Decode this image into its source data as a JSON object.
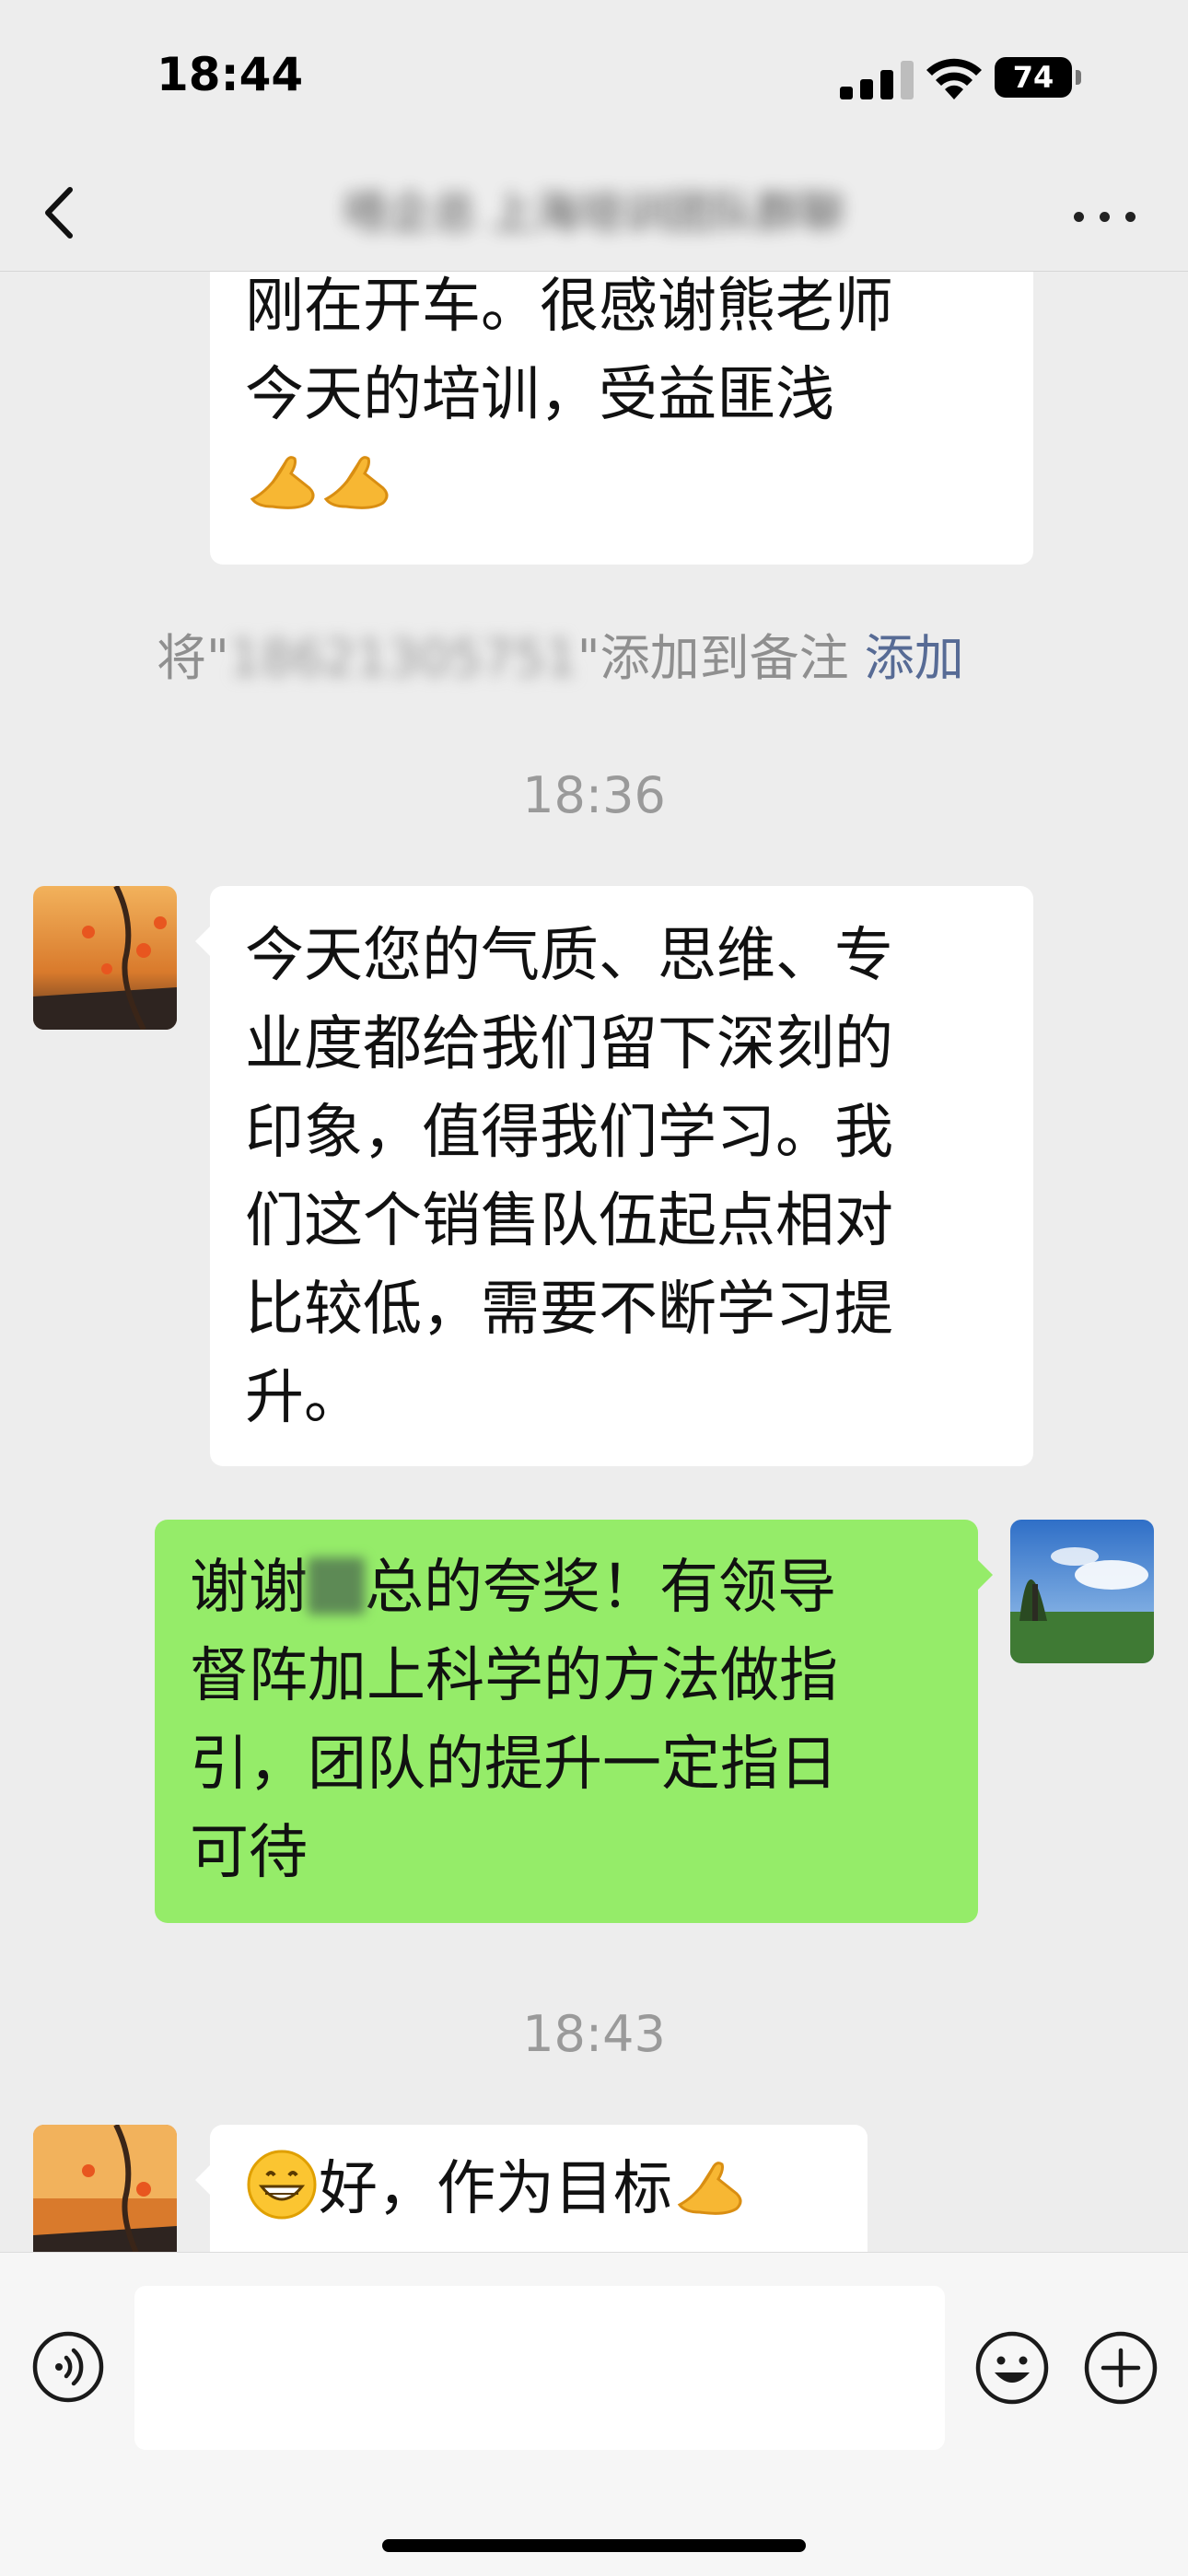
{
  "status_bar": {
    "time": "18:44",
    "battery": "74"
  },
  "nav": {
    "title": "唔企总 上海培训团队群聊"
  },
  "messages": {
    "m1_line1": "刚在开车。很感谢熊老师",
    "m1_line2": "今天的培训，受益匪浅",
    "note_prefix": "将\"",
    "note_number": "18621305751",
    "note_suffix": "\"添加到备注",
    "note_link": "添加",
    "time1": "18:36",
    "m2_lines": [
      "今天您的气质、思维、专",
      "业度都给我们留下深刻的",
      "印象，值得我们学习。我",
      "们这个销售队伍起点相对",
      "比较低，需要不断学习提",
      "升。"
    ],
    "m3_line1_a": "谢谢",
    "m3_line1_b": "总的夸奖！有领导",
    "m3_line2": "督阵加上科学的方法做指",
    "m3_line3": "引，团队的提升一定指日",
    "m3_line4": "可待",
    "time2": "18:43",
    "m4_text": "好，作为目标"
  },
  "icons": {
    "back": "chevron-left-icon",
    "more": "more-dots-icon",
    "voice": "voice-icon",
    "emoji": "smile-icon",
    "plus": "plus-circle-icon",
    "clap": "clasped-hands-emoji",
    "grin": "grinning-face-emoji"
  },
  "colors": {
    "accent_link": "#576b95",
    "my_bubble": "#95ec69",
    "background": "#ededed"
  }
}
